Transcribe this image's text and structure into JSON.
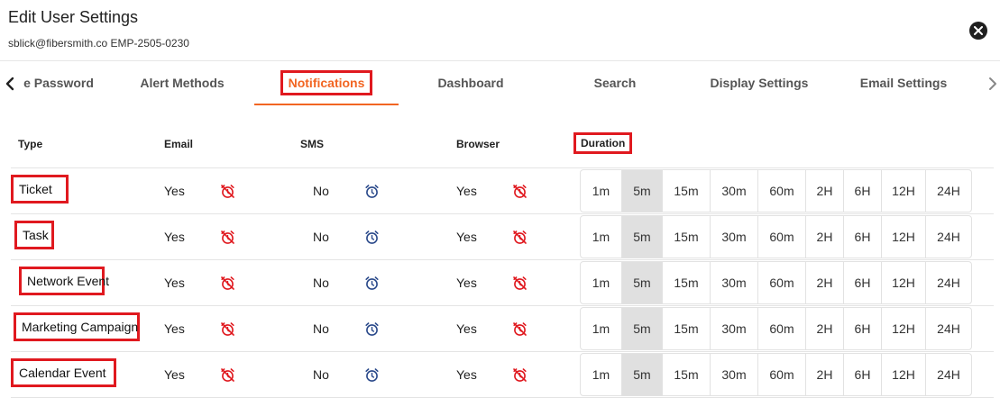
{
  "dialog": {
    "title": "Edit User Settings",
    "subtitle": "sblick@fibersmith.co EMP-2505-0230"
  },
  "tabs": [
    {
      "label": "e Password",
      "active": false
    },
    {
      "label": "Alert Methods",
      "active": false
    },
    {
      "label": "Notifications",
      "active": true
    },
    {
      "label": "Dashboard",
      "active": false
    },
    {
      "label": "Search",
      "active": false
    },
    {
      "label": "Display Settings",
      "active": false
    },
    {
      "label": "Email Settings",
      "active": false
    }
  ],
  "columns": {
    "type": "Type",
    "email": "Email",
    "sms": "SMS",
    "browser": "Browser",
    "duration": "Duration"
  },
  "duration_options": [
    "1m",
    "5m",
    "15m",
    "30m",
    "60m",
    "2H",
    "6H",
    "12H",
    "24H"
  ],
  "rows": [
    {
      "type": "Ticket",
      "email": "Yes",
      "sms": "No",
      "browser": "Yes",
      "duration": "5m"
    },
    {
      "type": "Task",
      "email": "Yes",
      "sms": "No",
      "browser": "Yes",
      "duration": "5m"
    },
    {
      "type": "Network Event",
      "email": "Yes",
      "sms": "No",
      "browser": "Yes",
      "duration": "5m"
    },
    {
      "type": "Marketing Campaign",
      "email": "Yes",
      "sms": "No",
      "browser": "Yes",
      "duration": "5m"
    },
    {
      "type": "Calendar Event",
      "email": "Yes",
      "sms": "No",
      "browser": "Yes",
      "duration": "5m"
    }
  ],
  "colors": {
    "accent": "#f26522",
    "highlight_box": "#e0191f",
    "alarm_off": "#e0191f",
    "alarm_on": "#2b4a8b",
    "selected_duration_bg": "#e0e0e0"
  }
}
